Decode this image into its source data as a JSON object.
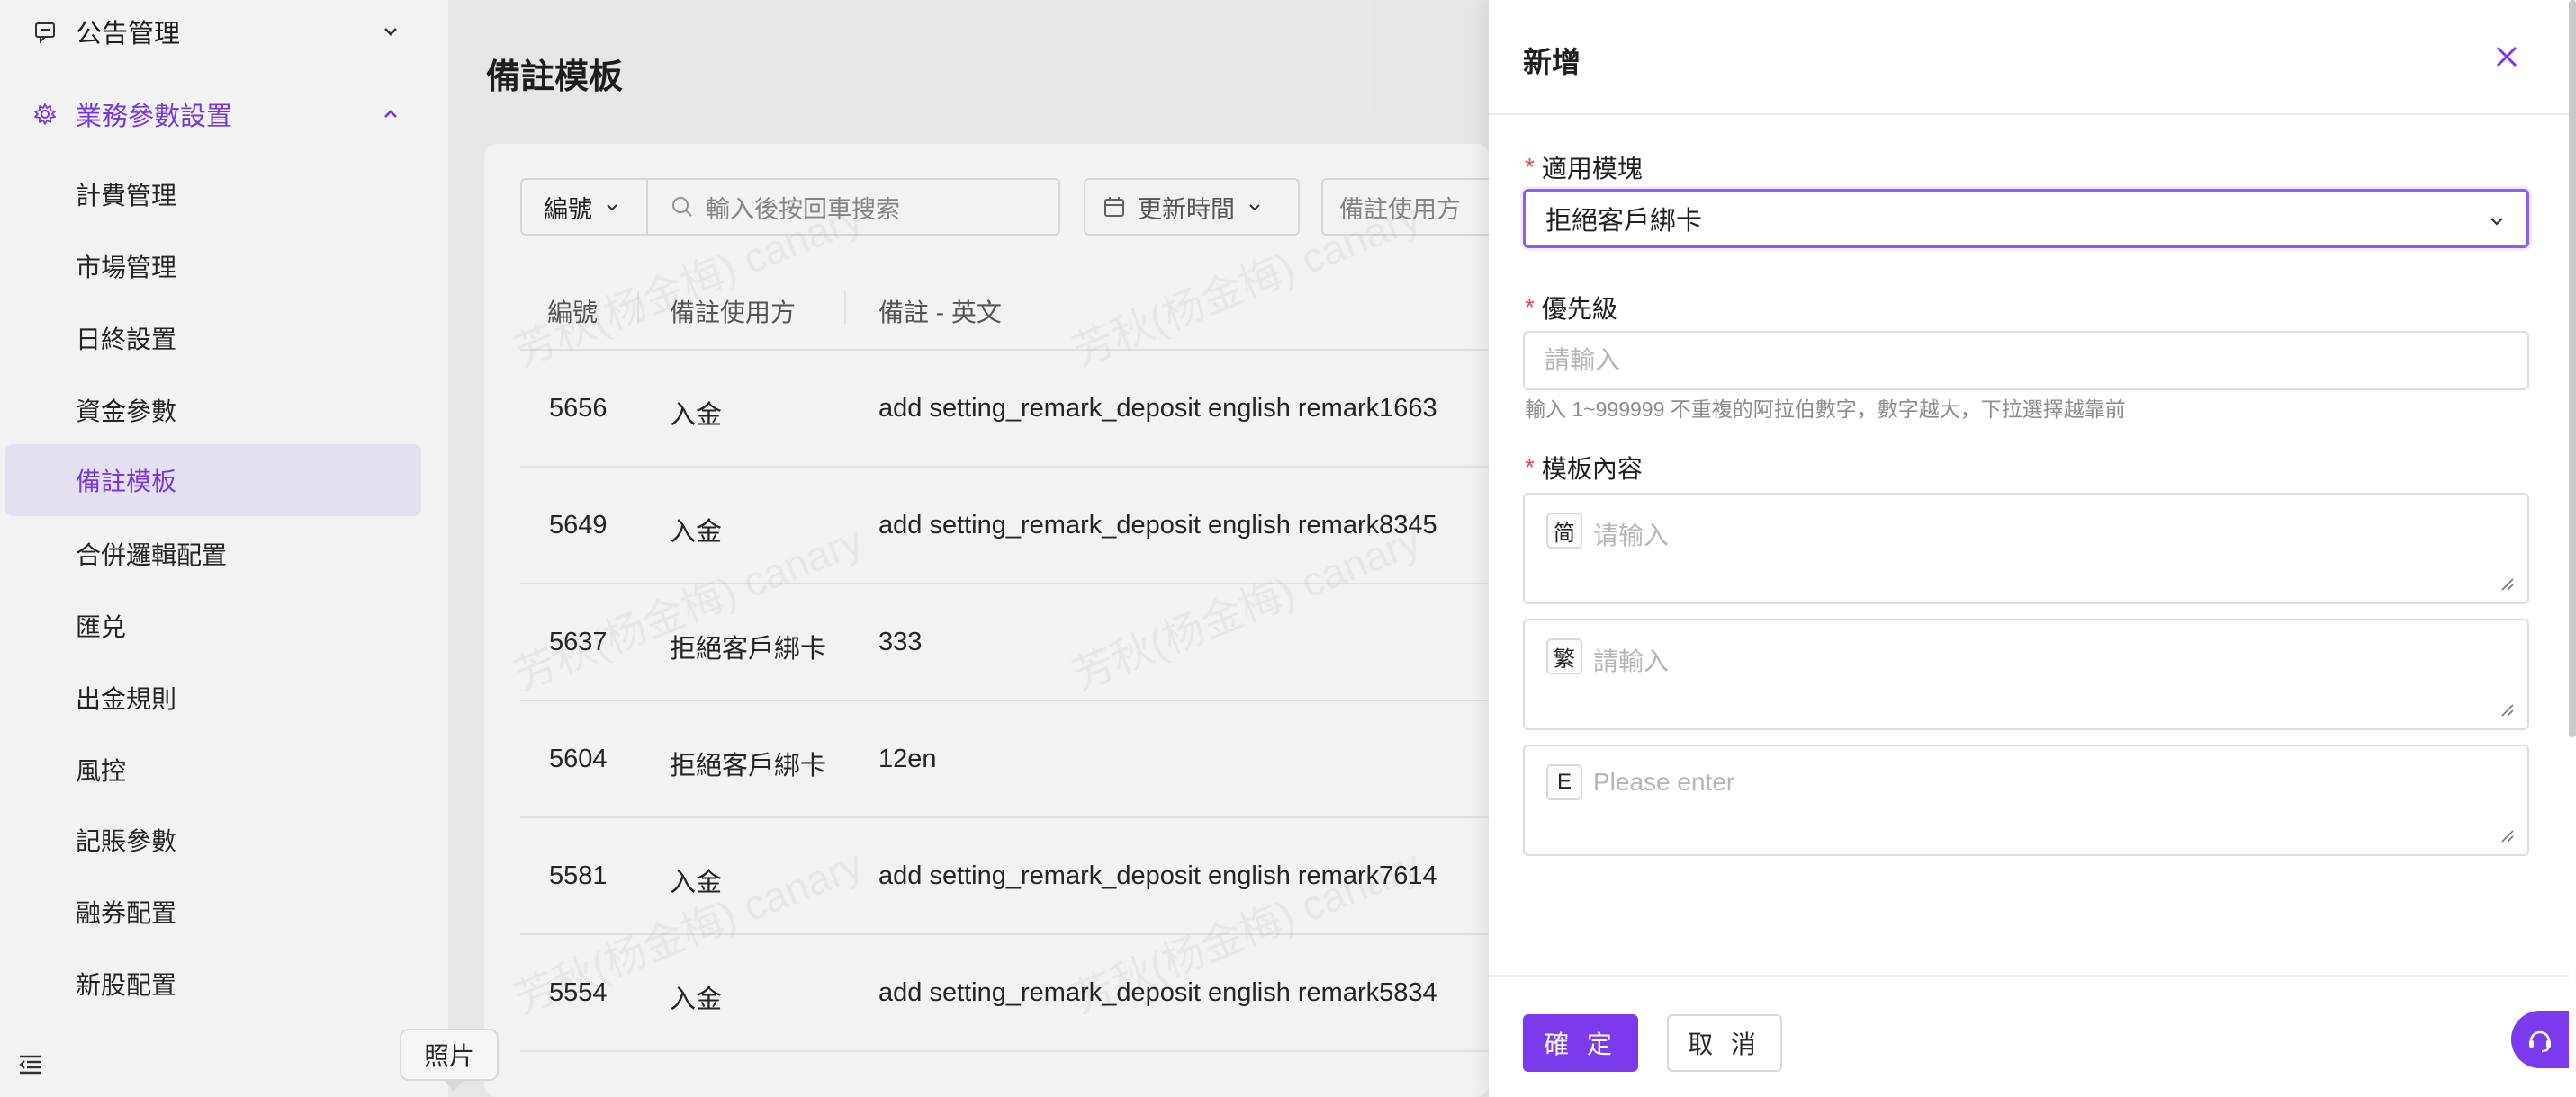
{
  "sidebar": {
    "groups": [
      {
        "label": "公告管理",
        "icon": "message-icon",
        "expanded": false
      },
      {
        "label": "業務參數設置",
        "icon": "gear-icon",
        "expanded": true
      }
    ],
    "items": [
      {
        "label": "計費管理"
      },
      {
        "label": "市場管理"
      },
      {
        "label": "日終設置"
      },
      {
        "label": "資金參數"
      },
      {
        "label": "備註模板",
        "selected": true
      },
      {
        "label": "合併邏輯配置"
      },
      {
        "label": "匯兑"
      },
      {
        "label": "出金規則"
      },
      {
        "label": "風控"
      },
      {
        "label": "記賬參數"
      },
      {
        "label": "融券配置"
      },
      {
        "label": "新股配置"
      }
    ],
    "collapse_icon": "menu-fold-icon"
  },
  "main": {
    "title": "備註模板",
    "filters": {
      "field_select": "編號",
      "search_placeholder": "輸入後按回車搜索",
      "date_filter": "更新時間",
      "user_filter": "備註使用方"
    },
    "table": {
      "columns": [
        "編號",
        "備註使用方",
        "備註 - 英文"
      ],
      "rows": [
        {
          "id": "5656",
          "user": "入金",
          "remark_en": "add setting_remark_deposit english remark1663"
        },
        {
          "id": "5649",
          "user": "入金",
          "remark_en": "add setting_remark_deposit english remark8345"
        },
        {
          "id": "5637",
          "user": "拒絕客戶綁卡",
          "remark_en": "333"
        },
        {
          "id": "5604",
          "user": "拒絕客戶綁卡",
          "remark_en": "12en"
        },
        {
          "id": "5581",
          "user": "入金",
          "remark_en": "add setting_remark_deposit english remark7614"
        },
        {
          "id": "5554",
          "user": "入金",
          "remark_en": "add setting_remark_deposit english remark5834"
        }
      ]
    },
    "watermark": "芳秋(杨金梅) canary"
  },
  "drawer": {
    "title": "新增",
    "module_label": "適用模塊",
    "module_value": "拒絕客戶綁卡",
    "priority_label": "優先級",
    "priority_placeholder": "請輸入",
    "priority_hint": "輸入 1~999999 不重複的阿拉伯數字，數字越大，下拉選擇越靠前",
    "content_label": "模板內容",
    "content_fields": [
      {
        "tag": "简",
        "placeholder": "请输入"
      },
      {
        "tag": "繁",
        "placeholder": "請輸入"
      },
      {
        "tag": "E",
        "placeholder": "Please enter"
      }
    ],
    "confirm_label": "確 定",
    "cancel_label": "取 消",
    "required_mark": "*"
  },
  "tooltip": {
    "text": "照片"
  },
  "colors": {
    "accent": "#7c3aed",
    "selected_bg": "#f1ecfd",
    "required": "#e5484d"
  }
}
